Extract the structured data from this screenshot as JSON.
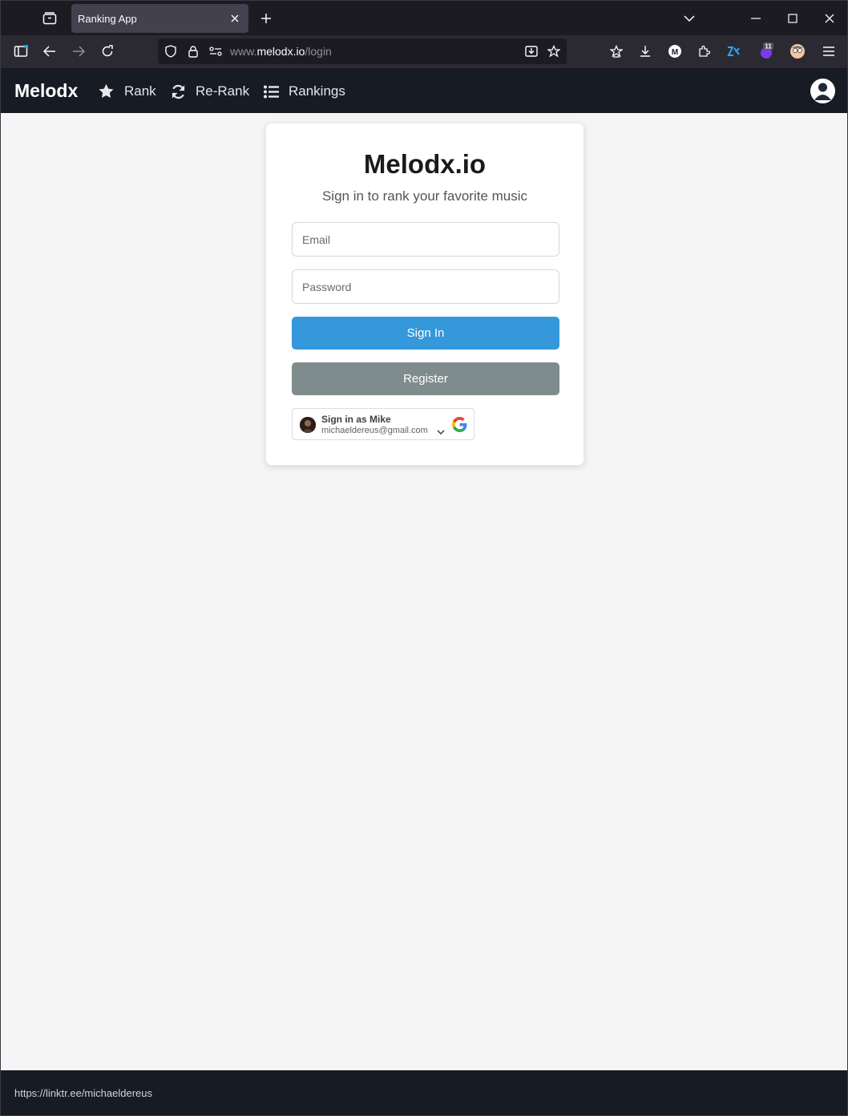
{
  "browser": {
    "tab_title": "Ranking App",
    "url_prefix": "www.",
    "url_host": "melodx.io",
    "url_path": "/login",
    "extension_badge": "11"
  },
  "header": {
    "brand": "Melodx",
    "nav": [
      {
        "label": "Rank",
        "icon": "star-icon"
      },
      {
        "label": "Re-Rank",
        "icon": "refresh-icon"
      },
      {
        "label": "Rankings",
        "icon": "list-icon"
      }
    ]
  },
  "login": {
    "title": "Melodx.io",
    "subtitle": "Sign in to rank your favorite music",
    "email_placeholder": "Email",
    "password_placeholder": "Password",
    "signin_label": "Sign In",
    "register_label": "Register",
    "google": {
      "name": "Sign in as Mike",
      "email": "michaeldereus@gmail.com"
    }
  },
  "colors": {
    "primary": "#3498db",
    "secondary": "#7f8c8d",
    "header_bg": "#161b24"
  },
  "status": {
    "link": "https://linktr.ee/michaeldereus"
  }
}
